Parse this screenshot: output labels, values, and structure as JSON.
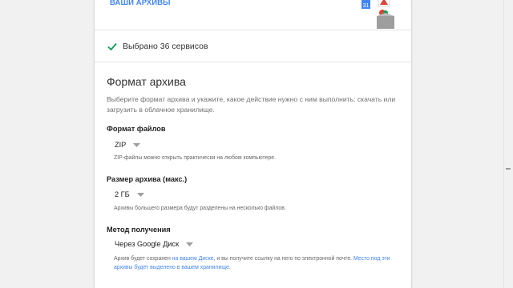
{
  "header": {
    "archives_link": "ВАШИ АРХИВЫ",
    "calendar_day": "31"
  },
  "selection": {
    "text": "Выбрано 36 сервисов",
    "icon": "check-icon"
  },
  "archive_format": {
    "title": "Формат архива",
    "description": "Выберите формат архива и укажите, какое действие нужно с ним выполнить: скачать или загрузить в облачное хранилище.",
    "file_type": {
      "label": "Формат файлов",
      "value": "ZIP",
      "hint": "ZIP-файлы можно открыть практически на любом компьютере."
    },
    "archive_size": {
      "label": "Размер архива (макс.)",
      "value": "2 ГБ",
      "hint": "Архивы большего размера будут разделены на несколько файлов."
    },
    "delivery": {
      "label": "Метод получения",
      "value": "Через Google Диск",
      "hint_start": "Архив будет сохранен ",
      "hint_link1": "на вашем Диске",
      "hint_middle": ", и вы получите ссылку на него по электронной почте. ",
      "hint_link2": "Место под эти архивы будет выделено в вашем хранилище",
      "hint_end": "."
    }
  },
  "colors": {
    "accent": "#4285f4",
    "check": "#0f9d58"
  }
}
